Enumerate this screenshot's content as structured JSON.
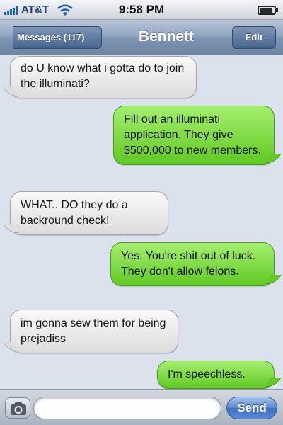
{
  "status_bar": {
    "carrier": "AT&T",
    "time": "9:58 PM",
    "signal_icon": "signal-bars-icon",
    "wifi_icon": "wifi-icon",
    "battery_icon": "battery-icon",
    "battery_level": 0.9
  },
  "nav": {
    "back_label": "Messages (117)",
    "title": "Bennett",
    "edit_label": "Edit"
  },
  "messages": [
    {
      "direction": "received",
      "text": "do U know what i gotta do to join the illuminati?"
    },
    {
      "direction": "sent",
      "text": "Fill out an illuminati application. They give $500,000 to new members."
    },
    {
      "direction": "received",
      "text": "WHAT.. DO they do a backround check!"
    },
    {
      "direction": "sent",
      "text": "Yes. You're shit out of luck. They don't allow felons."
    },
    {
      "direction": "received",
      "text": "im gonna sew them for being prejadiss"
    },
    {
      "direction": "sent",
      "text": "I'm speechless."
    }
  ],
  "input_bar": {
    "camera_icon": "camera-icon",
    "input_value": "",
    "input_placeholder": "",
    "send_label": "Send"
  },
  "colors": {
    "nav_bar": "#8ea3be",
    "sent_bubble": "#7fd844",
    "received_bubble": "#e8e8e8",
    "background": "#dbe2ed",
    "send_button": "#5785cd"
  }
}
